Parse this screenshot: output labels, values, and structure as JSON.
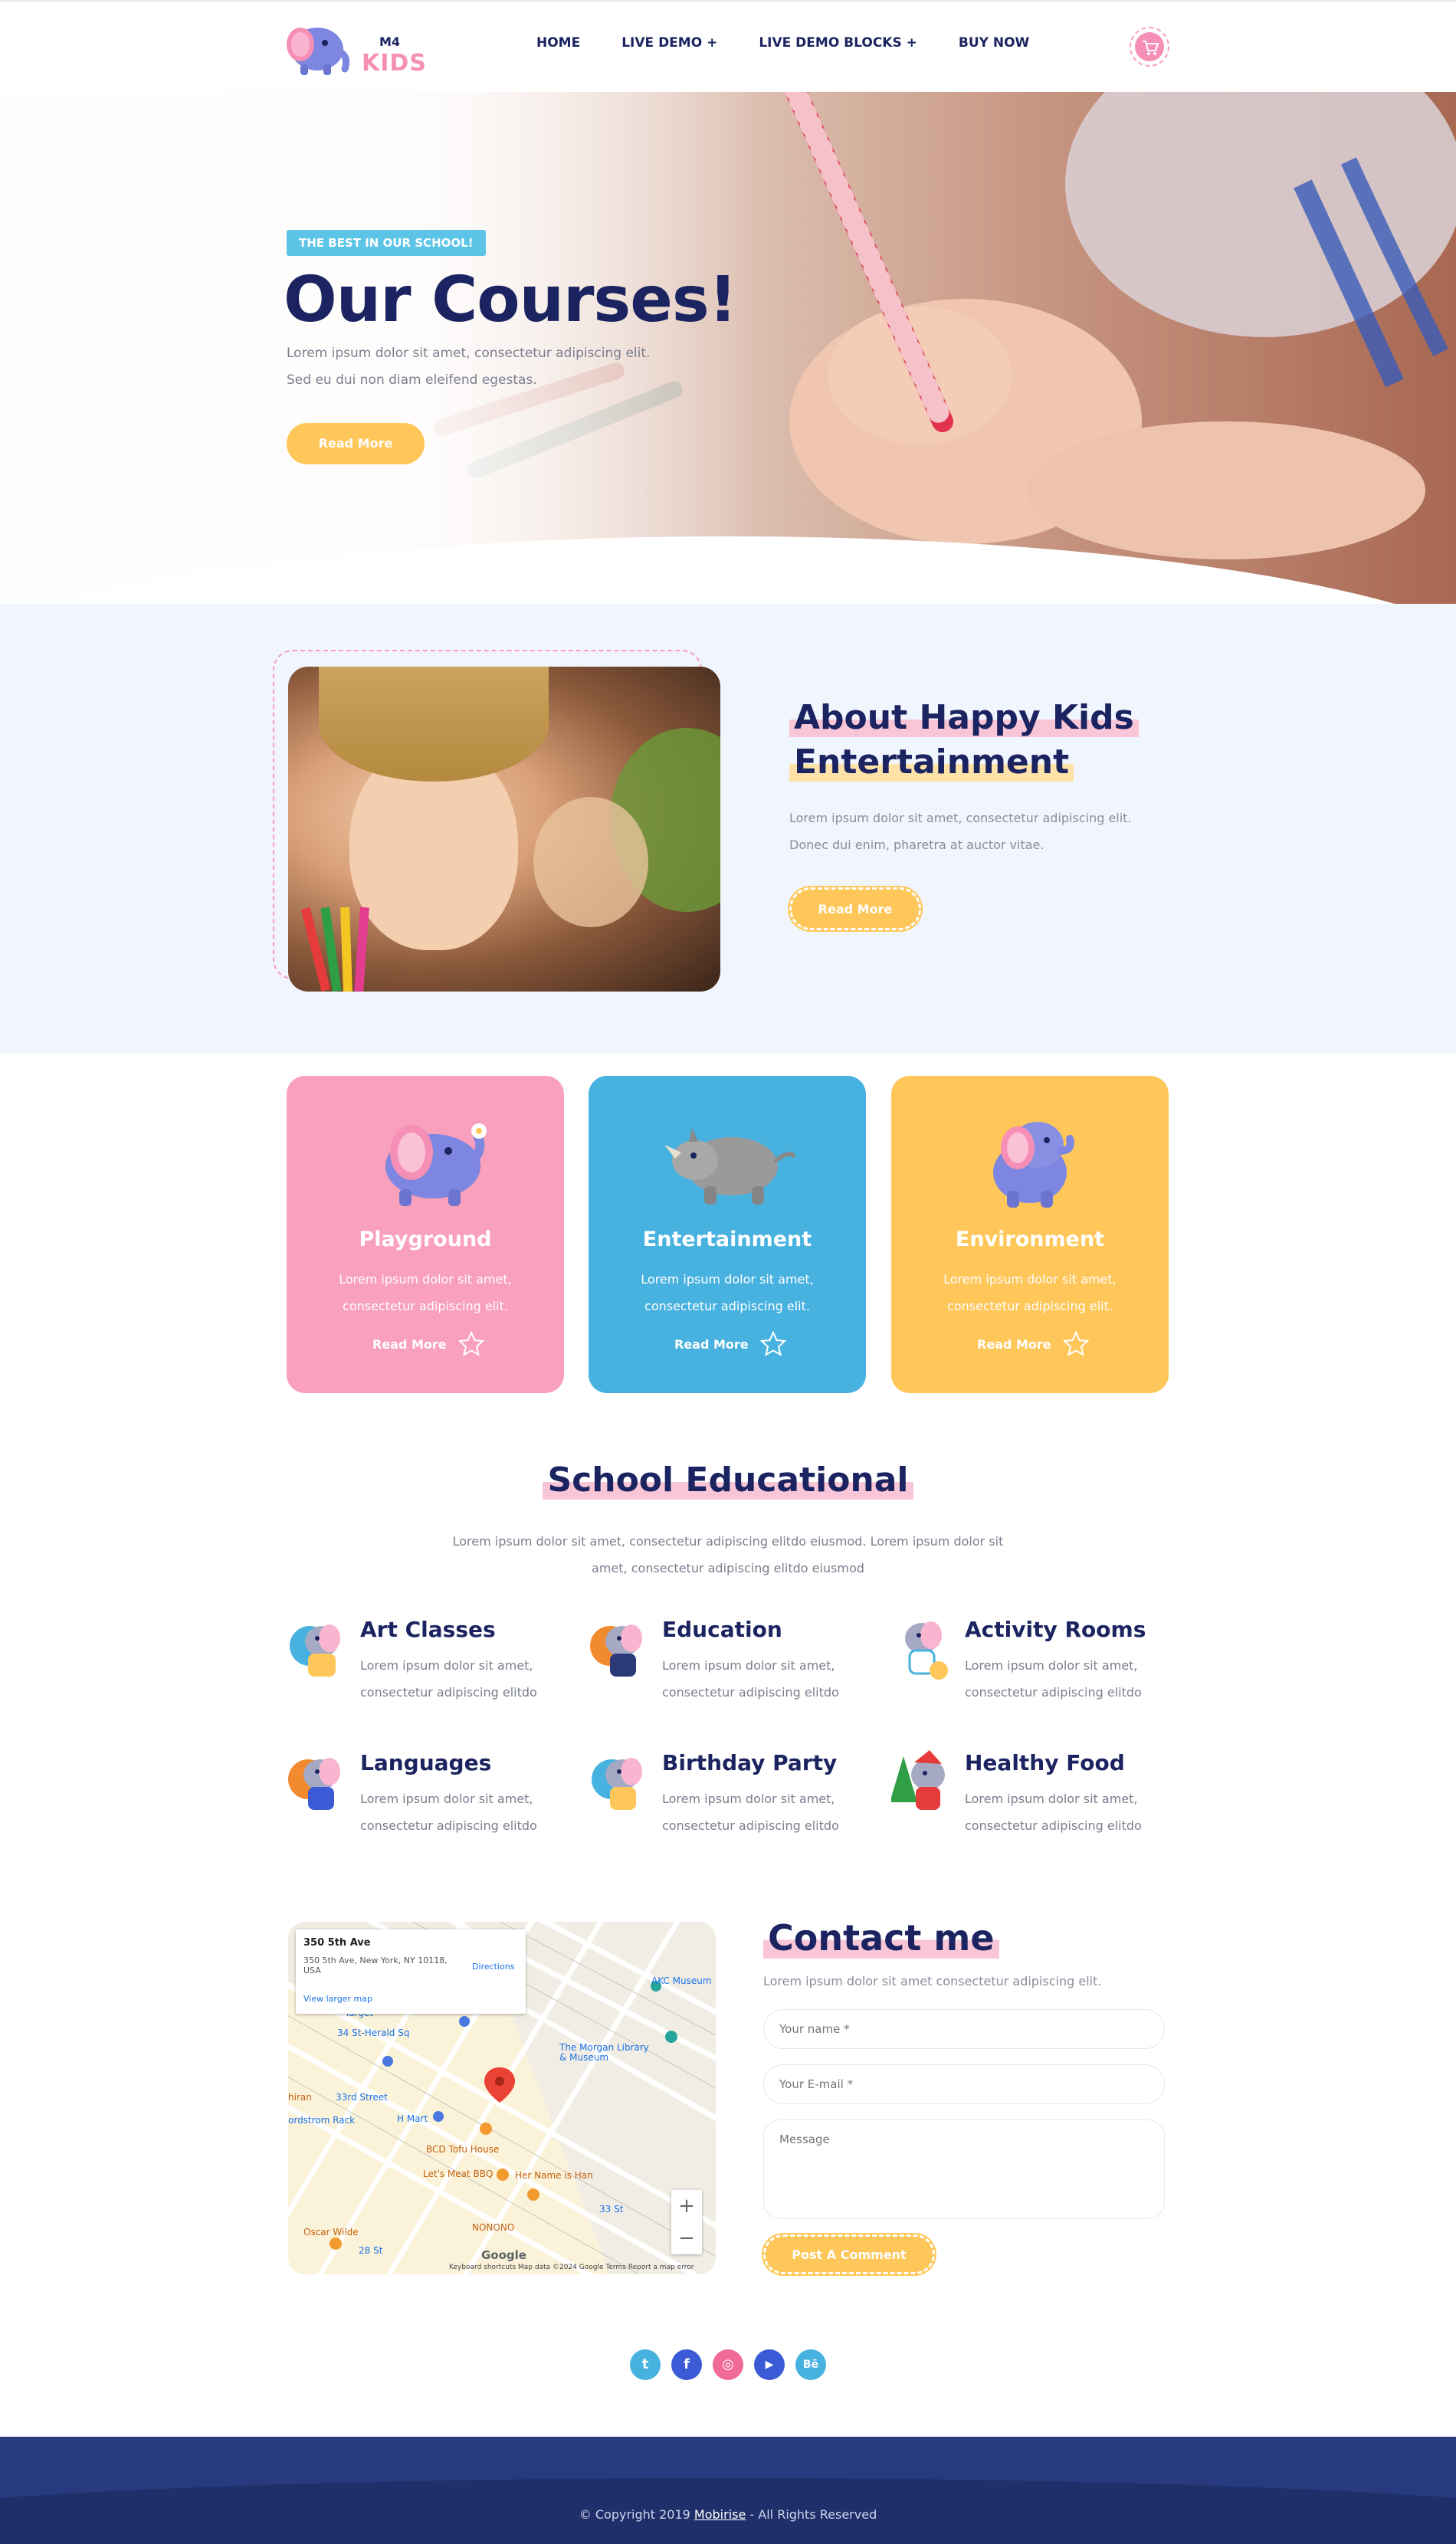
{
  "header": {
    "logo_small": "M4",
    "logo_big": "KIDS",
    "nav": [
      "HOME",
      "LIVE DEMO +",
      "LIVE DEMO BLOCKS +",
      "BUY NOW"
    ],
    "cart_icon": "cart-icon"
  },
  "hero": {
    "badge": "THE BEST IN OUR SCHOOL!",
    "title": "Our Courses!",
    "text_line1": "Lorem ipsum dolor sit amet, consectetur adipiscing elit.",
    "text_line2": "Sed eu dui non diam eleifend egestas.",
    "button": "Read More"
  },
  "about": {
    "title_line1": "About Happy Kids",
    "title_line2": "Entertainment",
    "text": "Lorem ipsum dolor sit amet, consectetur adipiscing elit. Donec dui enim, pharetra at auctor vitae.",
    "button": "Read More"
  },
  "cards": [
    {
      "title": "Playground",
      "text": "Lorem ipsum dolor sit amet, consectetur adipiscing elit.",
      "link": "Read More"
    },
    {
      "title": "Entertainment",
      "text": "Lorem ipsum dolor sit amet, consectetur adipiscing elit.",
      "link": "Read More"
    },
    {
      "title": "Environment",
      "text": "Lorem ipsum dolor sit amet, consectetur adipiscing elit.",
      "link": "Read More"
    }
  ],
  "education": {
    "title": "School Educational",
    "subtitle": "Lorem ipsum dolor sit amet, consectetur adipiscing elitdo eiusmod. Lorem ipsum dolor sit amet, consectetur adipiscing elitdo eiusmod",
    "features": [
      {
        "title": "Art Classes",
        "text": "Lorem ipsum dolor sit amet, consectetur adipiscing elitdo"
      },
      {
        "title": "Education",
        "text": "Lorem ipsum dolor sit amet, consectetur adipiscing elitdo"
      },
      {
        "title": "Activity Rooms",
        "text": "Lorem ipsum dolor sit amet, consectetur adipiscing elitdo"
      },
      {
        "title": "Languages",
        "text": "Lorem ipsum dolor sit amet, consectetur adipiscing elitdo"
      },
      {
        "title": "Birthday Party",
        "text": "Lorem ipsum dolor sit amet, consectetur adipiscing elitdo"
      },
      {
        "title": "Healthy Food",
        "text": "Lorem ipsum dolor sit amet, consectetur adipiscing elitdo"
      }
    ]
  },
  "map": {
    "address": "350 5th Ave",
    "address_full": "350 5th Ave, New York, NY 10118, USA",
    "larger_map": "View larger map",
    "directions": "Directions",
    "labels": [
      "AKC Museum",
      "The Morgan Library & Museum",
      "34 St-Herald Sq",
      "Target",
      "33rd Street",
      "H Mart",
      "BCD Tofu House",
      "Let's Meat BBQ",
      "Her Name is Han",
      "33 St",
      "NONONO",
      "Oscar Wilde",
      "28 St",
      "ordstrom Rack",
      "hiran"
    ],
    "zoom_in": "+",
    "zoom_out": "−",
    "google": "Google",
    "footer": "Keyboard shortcuts   Map data ©2024 Google   Terms   Report a map error"
  },
  "contact": {
    "title": "Contact me",
    "subtitle": "Lorem ipsum dolor sit amet consectetur adipiscing elit.",
    "name_placeholder": "Your name *",
    "email_placeholder": "Your E-mail *",
    "message_placeholder": "Message",
    "button": "Post A Comment"
  },
  "social": [
    {
      "name": "twitter-icon",
      "glyph": "t",
      "color": "#47b2e0"
    },
    {
      "name": "facebook-icon",
      "glyph": "f",
      "color": "#3b5bd6"
    },
    {
      "name": "instagram-icon",
      "glyph": "◎",
      "color": "#f06a9a"
    },
    {
      "name": "youtube-icon",
      "glyph": "▶",
      "color": "#3b5bd6"
    },
    {
      "name": "behance-icon",
      "glyph": "Bē",
      "color": "#47b2e0"
    }
  ],
  "footer": {
    "prefix": "© Copyright 2019 ",
    "link": "Mobirise",
    "suffix": " - All Rights Reserved"
  },
  "colors": {
    "navy": "#1b2460",
    "pink": "#f9a0bd",
    "blue": "#47b2e0",
    "yellow": "#ffc75a",
    "light_bg": "#f1f5fd",
    "footer_bg": "#273a7d"
  }
}
